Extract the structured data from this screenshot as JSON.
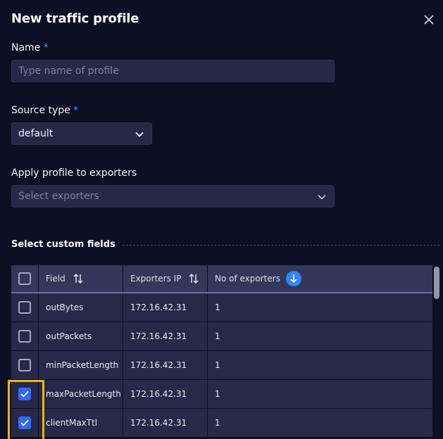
{
  "dialog": {
    "title": "New traffic profile"
  },
  "form": {
    "name_label": "Name",
    "name_placeholder": "Type name of profile",
    "required_marker": "*",
    "source_type_label": "Source type",
    "source_type_value": "default",
    "exporters_label": "Apply profile to exporters",
    "exporters_placeholder": "Select exporters"
  },
  "custom_fields": {
    "section_title": "Select custom fields",
    "columns": {
      "field": "Field",
      "exporters_ip": "Exporters IP",
      "no_of_exporters": "No of exporters"
    },
    "rows": [
      {
        "field": "outBytes",
        "ip": "172.16.42.31",
        "count": "1",
        "checked": false
      },
      {
        "field": "outPackets",
        "ip": "172.16.42.31",
        "count": "1",
        "checked": false
      },
      {
        "field": "minPacketLength",
        "ip": "172.16.42.31",
        "count": "1",
        "checked": false
      },
      {
        "field": "maxPacketLength",
        "ip": "172.16.42.31",
        "count": "1",
        "checked": true
      },
      {
        "field": "clientMaxTtl",
        "ip": "172.16.42.31",
        "count": "1",
        "checked": true
      }
    ]
  },
  "colors": {
    "background": "#0d0f24",
    "accent": "#2f6bff",
    "highlight": "#f2b400"
  }
}
